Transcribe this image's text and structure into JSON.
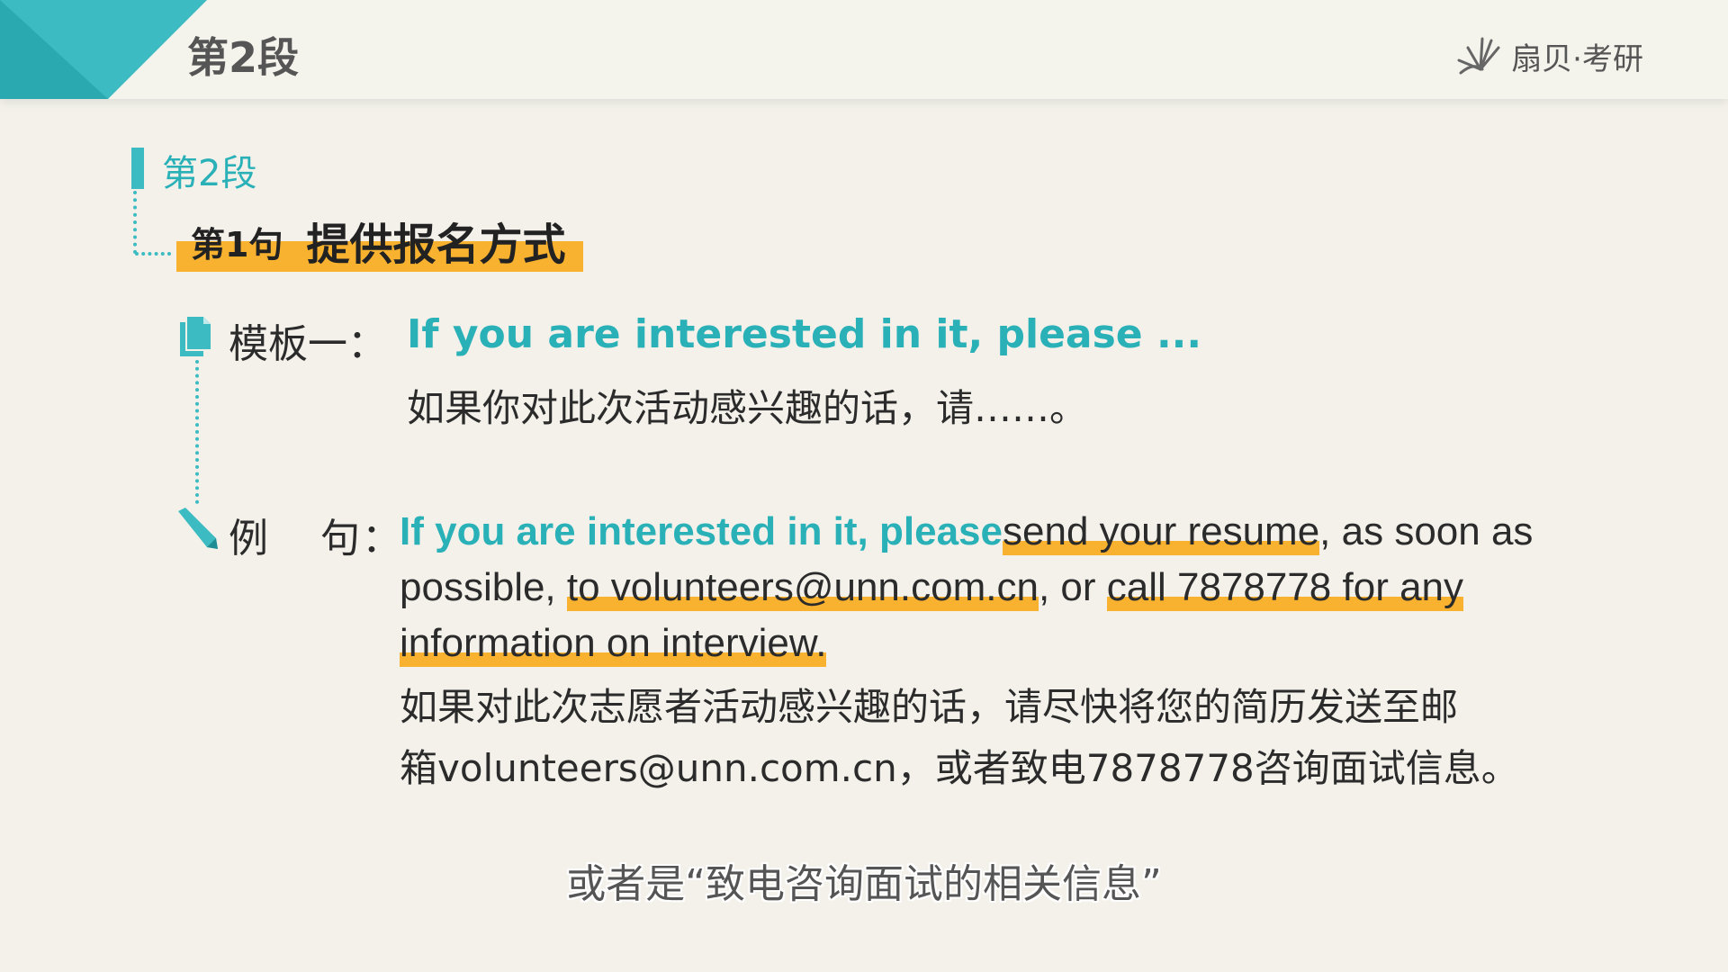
{
  "header": {
    "title": "第2段",
    "brand": "扇贝·考研",
    "accent_color": "#3cbcc2",
    "icons": [
      "teal-corner-decoration",
      "shanbay-logo-icon"
    ]
  },
  "section": {
    "label": "第2段"
  },
  "sentence": {
    "number": "第1句",
    "title": "提供报名方式",
    "highlight_color": "#f8b230"
  },
  "template": {
    "label": "模板一：",
    "english": "If you are interested in it, please ...",
    "chinese": "如果你对此次活动感兴趣的话，请……。",
    "icon": "document-icon"
  },
  "example": {
    "label_a": "例",
    "label_b": "句：",
    "icon": "pen-icon",
    "english_parts": {
      "template_part": "If you are interested in it, please",
      "p1": "send your resume",
      "p2": ", as soon as possible, ",
      "p3": "to volunteers@unn.com.cn",
      "p4": ", or ",
      "p5": "call 7878778 for any information on interview."
    },
    "chinese_line1": "如果对此次志愿者活动感兴趣的话，请尽快将您的简历发送至邮",
    "chinese_line2": "箱volunteers@unn.com.cn，或者致电7878778咨询面试信息。"
  },
  "caption": "或者是“致电咨询面试的相关信息”"
}
